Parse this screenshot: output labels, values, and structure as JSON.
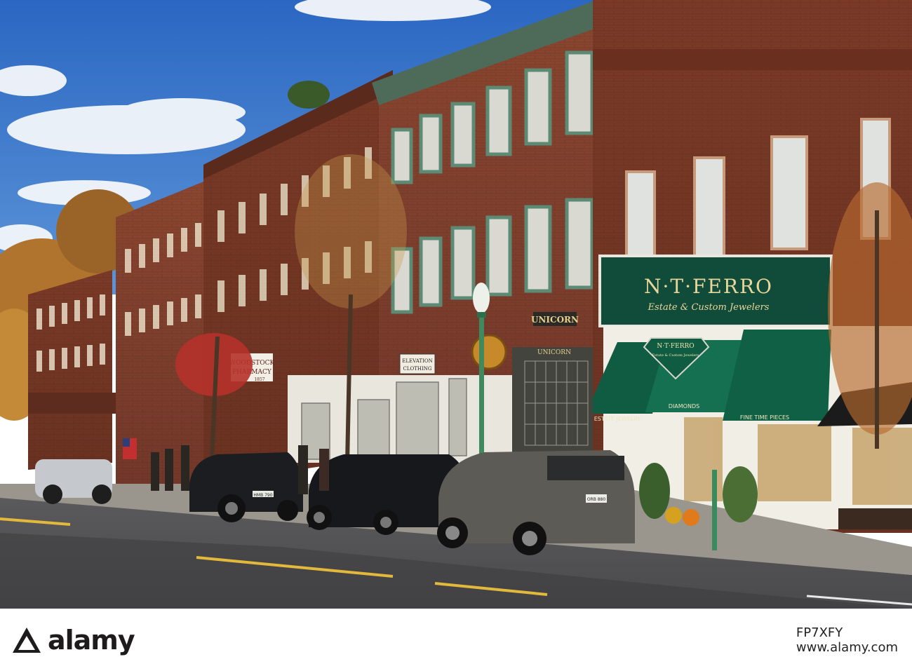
{
  "scene": {
    "sky_color": "#2f6fc6",
    "brick_color": "#7a3b28",
    "awning_color": "#0f5c42"
  },
  "signs": {
    "jeweler_name": "N·T·FERRO",
    "jeweler_sub": "Estate & Custom Jewelers",
    "jeweler_small_name": "N·T·FERRO",
    "jeweler_small_sub": "Estate & Custom Jewelers",
    "awning_left": "ESTATE JEWELRY",
    "awning_mid": "DIAMONDS",
    "awning_right": "FINE TIME PIECES",
    "unicorn_top": "UNICORN",
    "unicorn_low": "UNICORN",
    "pharmacy_1": "WOODSTOCK",
    "pharmacy_2": "PHARMACY",
    "pharmacy_3": "1857",
    "elevation_1": "ELEVATION",
    "elevation_2": "CLOTHING"
  },
  "plates": {
    "left_suv": "HMB 790",
    "right_suv": "ORB 880"
  },
  "watermark": {
    "brand": "alamy",
    "image_id": "FP7XFY",
    "site": "www.alamy.com",
    "logo_icon": "alamy-logo-icon"
  }
}
